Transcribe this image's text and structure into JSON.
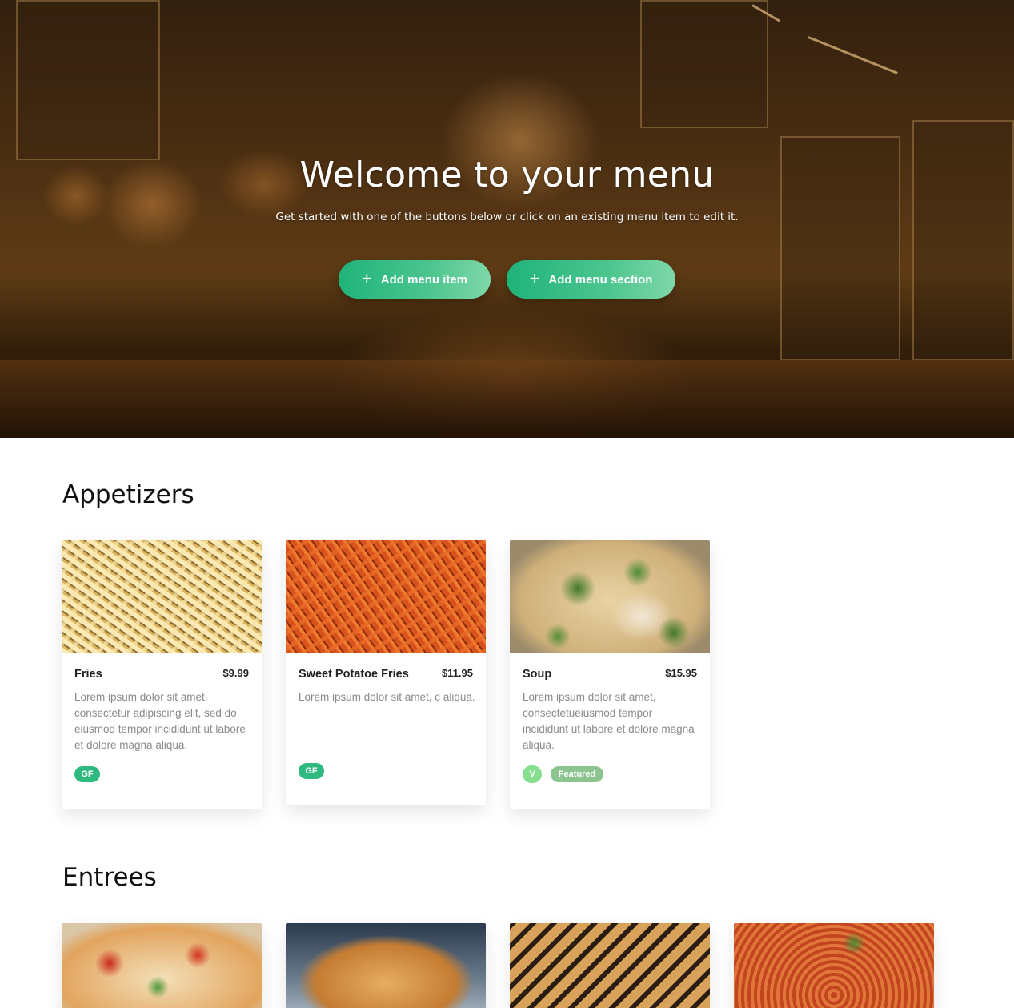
{
  "hero": {
    "title": "Welcome to your menu",
    "subtitle": "Get started with one of the buttons below or click on an existing menu item to edit it.",
    "add_item_label": "Add menu item",
    "add_section_label": "Add menu section",
    "plus_glyph": "+",
    "accent_color": "#2eb97f"
  },
  "sections": [
    {
      "title": "Appetizers",
      "items": [
        {
          "name": "Fries",
          "price": "$9.99",
          "description": "Lorem ipsum dolor sit amet, consectetur adipiscing elit, sed do eiusmod tempor incididunt ut labore et dolore magna aliqua.",
          "tags": [
            "GF"
          ]
        },
        {
          "name": "Sweet Potatoe Fries",
          "price": "$11.95",
          "description": "Lorem ipsum dolor sit amet, c aliqua.",
          "tags": [
            "GF"
          ]
        },
        {
          "name": "Soup",
          "price": "$15.95",
          "description": "Lorem ipsum dolor sit amet, consectetueiusmod tempor incididunt ut labore et dolore magna aliqua.",
          "tags": [
            "V",
            "Featured"
          ]
        }
      ]
    },
    {
      "title": "Entrees",
      "items": [
        {
          "name": "",
          "image": "pizza"
        },
        {
          "name": "",
          "image": "burger"
        },
        {
          "name": "",
          "image": "panini"
        },
        {
          "name": "",
          "image": "pasta"
        }
      ]
    }
  ]
}
